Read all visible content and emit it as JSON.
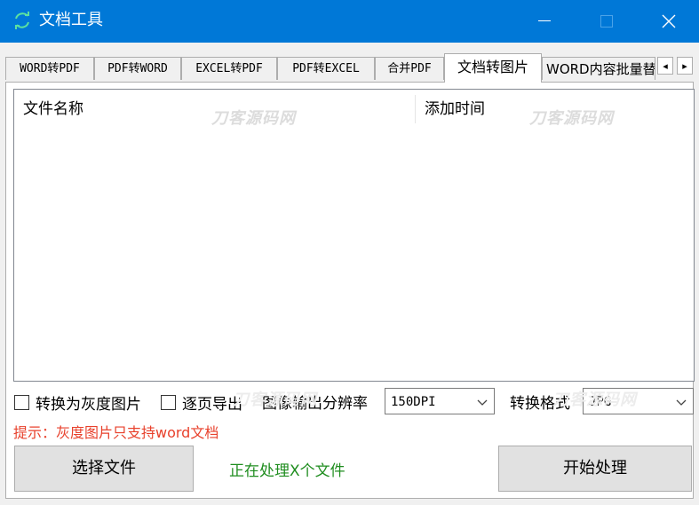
{
  "window": {
    "title": "文档工具",
    "accent": "#0078d7",
    "icons": {
      "app": "refresh-icon",
      "minimize": "minimize-icon",
      "maximize": "maximize-icon",
      "close": "close-icon"
    }
  },
  "tabs": [
    {
      "label": "WORD转PDF"
    },
    {
      "label": "PDF转WORD"
    },
    {
      "label": "EXCEL转PDF"
    },
    {
      "label": "PDF转EXCEL"
    },
    {
      "label": "合并PDF"
    },
    {
      "label": "文档转图片",
      "active": true
    },
    {
      "label": "WORD内容批量替"
    }
  ],
  "tab_scroll": {
    "left": "◂",
    "right": "▸"
  },
  "list": {
    "columns": [
      "文件名称",
      "添加时间"
    ],
    "rows": []
  },
  "watermarks": [
    "刀客源码网",
    "刀客源码网",
    "刀客源码网",
    "刀客源码网"
  ],
  "options": {
    "grayscale_label": "转换为灰度图片",
    "per_page_label": "逐页导出",
    "resolution_label": "图像输出分辨率",
    "resolution_value": "150DPI",
    "format_label": "转换格式",
    "format_value": "JPG"
  },
  "hint": "提示：灰度图片只支持word文档",
  "actions": {
    "select_file": "选择文件",
    "status": "正在处理X个文件",
    "start": "开始处理"
  }
}
